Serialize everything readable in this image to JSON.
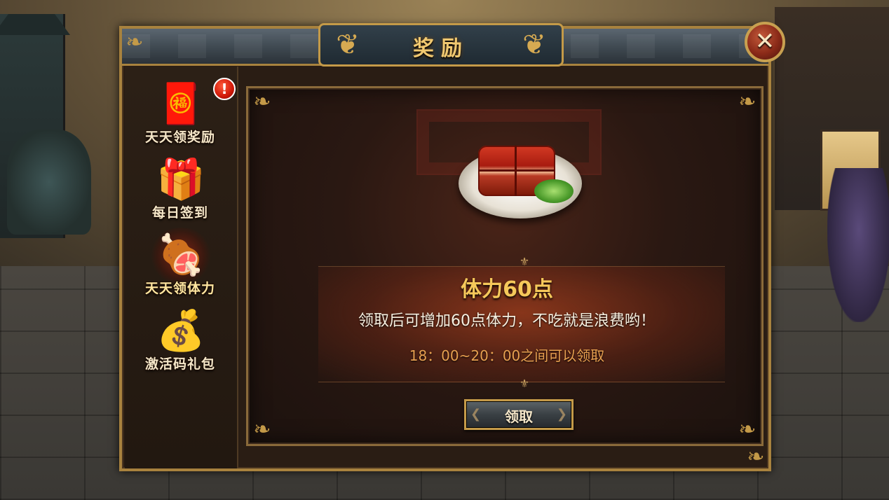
{
  "dialog": {
    "title": "奖励",
    "close_glyph": "✕"
  },
  "sidebar": {
    "items": [
      {
        "label": "天天领奖励",
        "icon": "red-envelope-icon",
        "glyph": "🧧",
        "alert": "!"
      },
      {
        "label": "每日签到",
        "icon": "gift-box-icon",
        "glyph": "🎁"
      },
      {
        "label": "天天领体力",
        "icon": "braised-pork-icon",
        "glyph": "🍖",
        "active": true
      },
      {
        "label": "激活码礼包",
        "icon": "treasure-chest-icon",
        "glyph": "💰"
      }
    ]
  },
  "reward": {
    "image": "braised-pork-dish-icon",
    "title": "体力60点",
    "description": "领取后可增加60点体力，不吃就是浪费哟！",
    "time_window": "18：00~20：00之间可以领取",
    "claim_label": "领取"
  },
  "colors": {
    "frame_gold": "#c49a48",
    "title_gold": "#f5c85a",
    "time_orange": "#e8a050",
    "alert_red": "#d01808"
  }
}
